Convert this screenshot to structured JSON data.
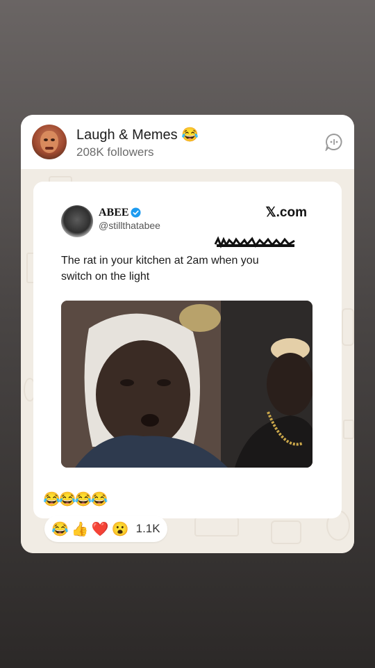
{
  "channel": {
    "name": "Laugh & Memes 😂",
    "followers": "208K followers"
  },
  "post": {
    "tweet": {
      "author_name": "ABEE",
      "author_handle": "@stillthatabee",
      "brand": "𝕏.com",
      "text": "The rat in your kitchen at 2am when you switch on the light"
    },
    "caption": "😂😂😂😂"
  },
  "reactions": {
    "emojis": [
      "😂",
      "👍",
      "❤️",
      "😮"
    ],
    "count": "1.1K"
  },
  "colors": {
    "verified": "#1d9bf0",
    "card_bg": "#f1ece4"
  }
}
